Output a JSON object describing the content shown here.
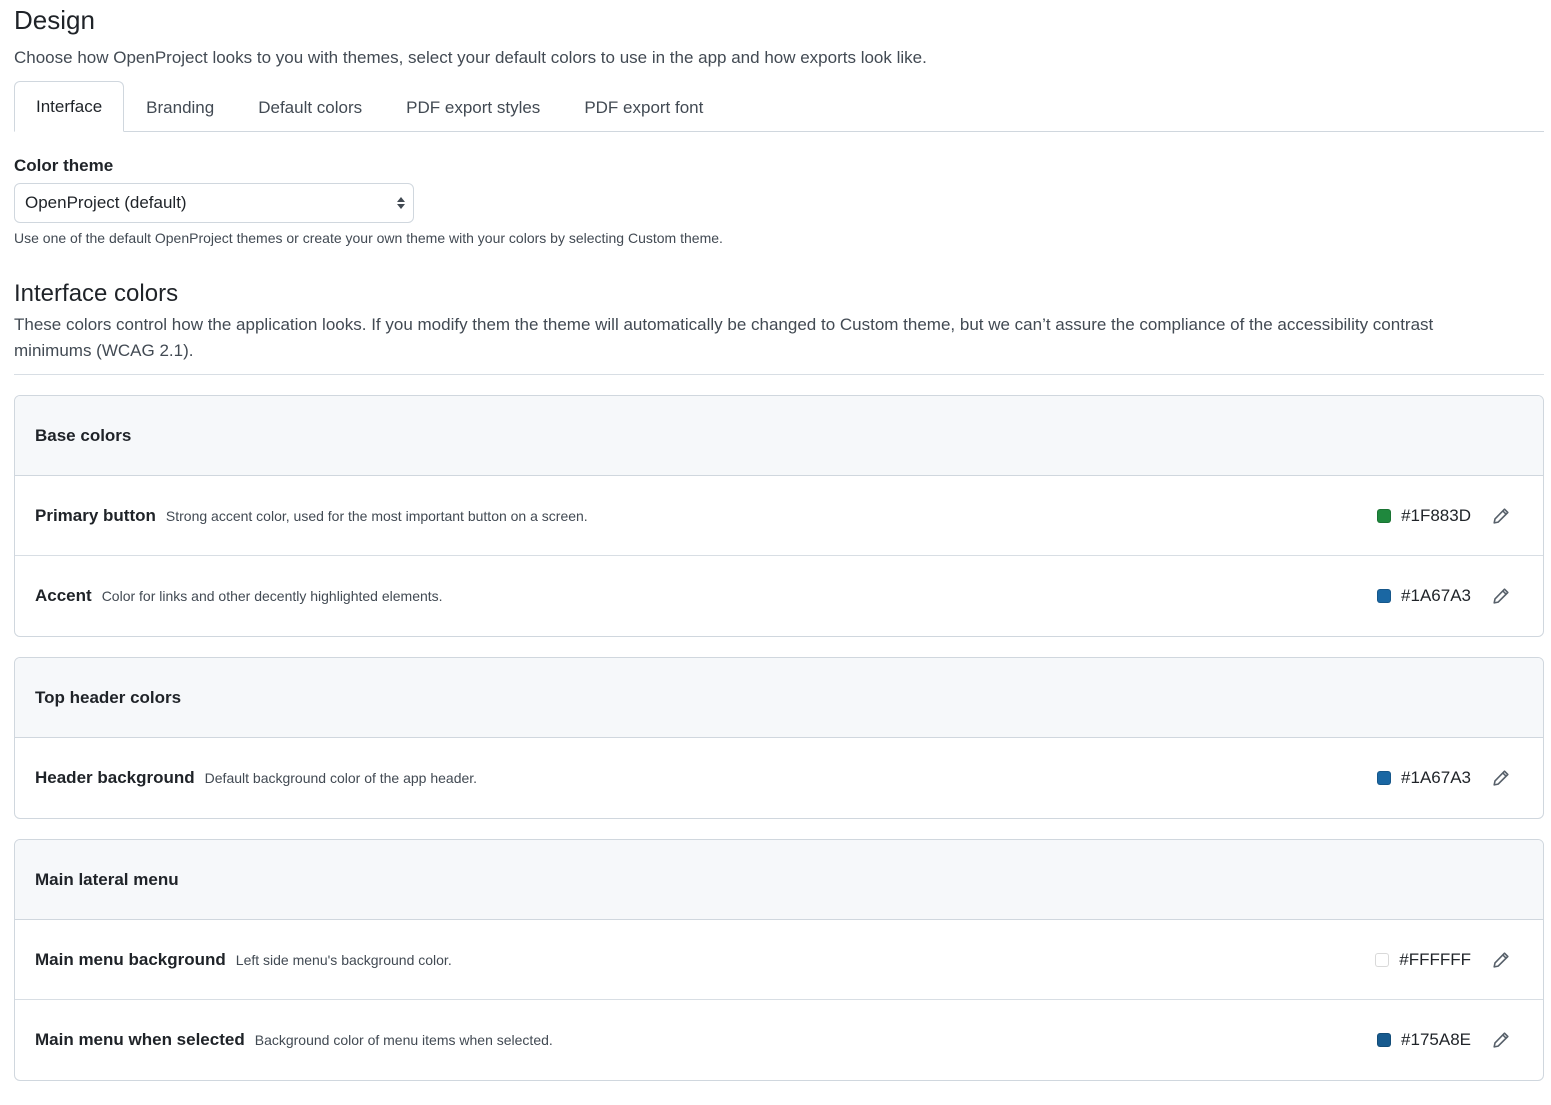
{
  "page": {
    "title": "Design",
    "description": "Choose how OpenProject looks to you with themes, select your default colors to use in the app and how exports look like."
  },
  "tabs": [
    {
      "label": "Interface",
      "selected": true
    },
    {
      "label": "Branding",
      "selected": false
    },
    {
      "label": "Default colors",
      "selected": false
    },
    {
      "label": "PDF export styles",
      "selected": false
    },
    {
      "label": "PDF export font",
      "selected": false
    }
  ],
  "color_theme": {
    "label": "Color theme",
    "selected_value": "OpenProject (default)",
    "caption": "Use one of the default OpenProject themes or create your own theme with your colors by selecting Custom theme."
  },
  "interface_colors": {
    "title": "Interface colors",
    "description": "These colors control how the application looks. If you modify them the theme will automatically be changed to Custom theme, but we can’t assure the compliance of the accessibility contrast minimums (WCAG 2.1)."
  },
  "groups": [
    {
      "title": "Base colors",
      "rows": [
        {
          "name": "Primary button",
          "description": "Strong accent color, used for the most important button on a screen.",
          "hex": "#1F883D",
          "swatch": "#1F883D"
        },
        {
          "name": "Accent",
          "description": "Color for links and other decently highlighted elements.",
          "hex": "#1A67A3",
          "swatch": "#1A67A3"
        }
      ]
    },
    {
      "title": "Top header colors",
      "rows": [
        {
          "name": "Header background",
          "description": "Default background color of the app header.",
          "hex": "#1A67A3",
          "swatch": "#1A67A3"
        }
      ]
    },
    {
      "title": "Main lateral menu",
      "rows": [
        {
          "name": "Main menu background",
          "description": "Left side menu's background color.",
          "hex": "#FFFFFF",
          "swatch": "#FFFFFF"
        },
        {
          "name": "Main menu when selected",
          "description": "Background color of menu items when selected.",
          "hex": "#175A8E",
          "swatch": "#175A8E"
        }
      ]
    }
  ],
  "icons": {
    "edit": "pencil-icon",
    "select": "select-arrows-icon"
  }
}
